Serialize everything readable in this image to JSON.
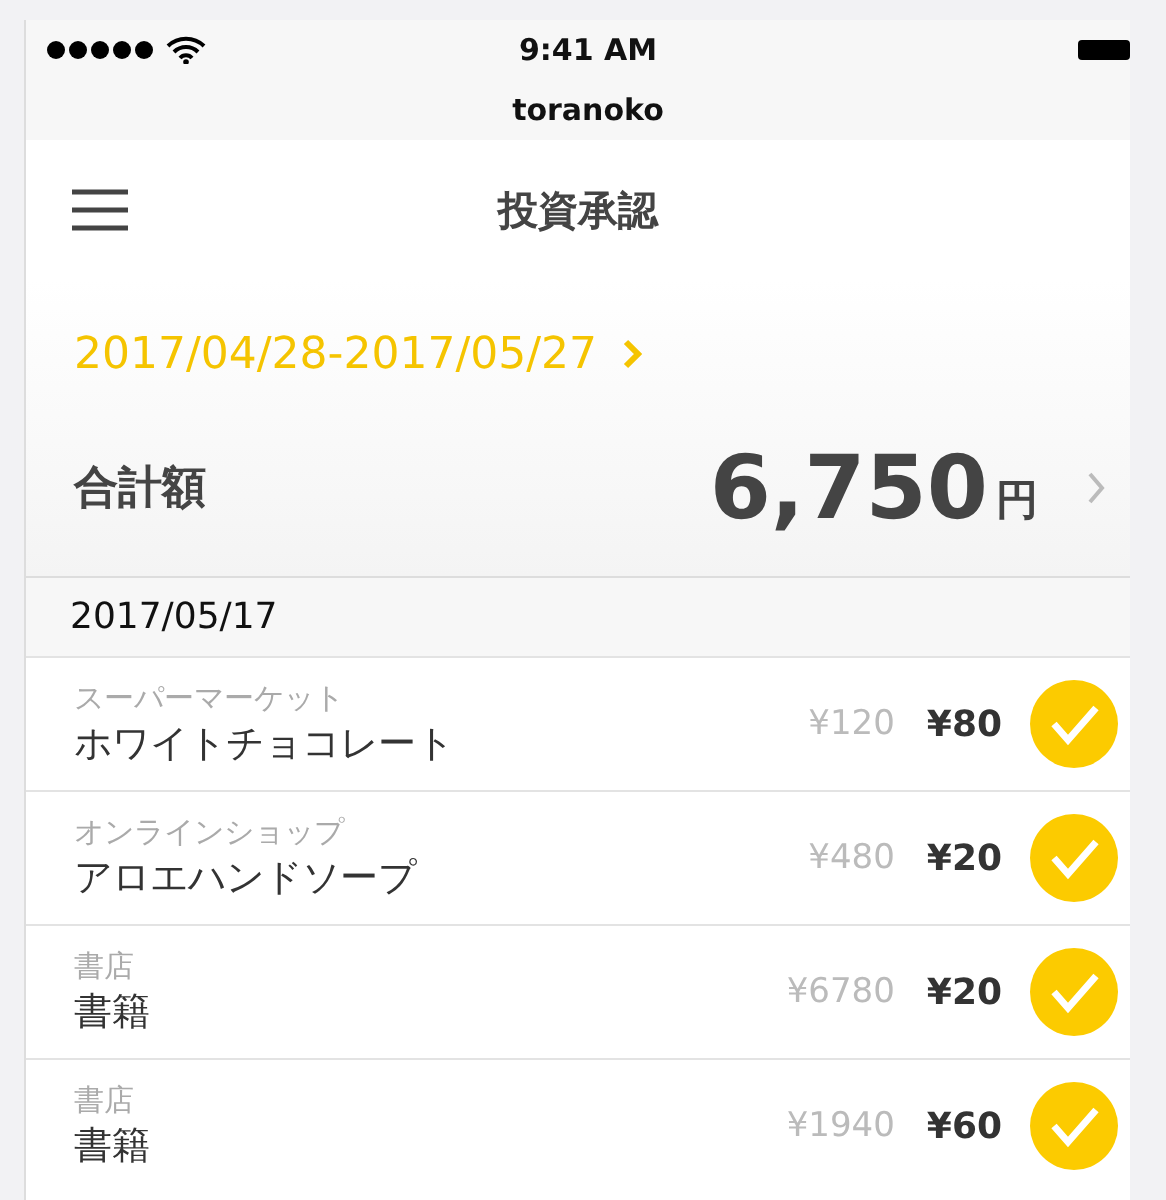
{
  "status_bar": {
    "time": "9:41 AM",
    "carrier": "toranoko"
  },
  "nav": {
    "title": "投資承認"
  },
  "period": {
    "range": "2017/04/28-2017/05/27"
  },
  "total": {
    "label": "合計額",
    "amount": "6,750",
    "unit": "円"
  },
  "sections": [
    {
      "date": "2017/05/17",
      "items": [
        {
          "shop": "スーパーマーケット",
          "name": "ホワイトチョコレート",
          "price": "¥120",
          "invest": "¥80",
          "checked": true
        },
        {
          "shop": "オンラインショップ",
          "name": "アロエハンドソープ",
          "price": "¥480",
          "invest": "¥20",
          "checked": true
        },
        {
          "shop": "書店",
          "name": "書籍",
          "price": "¥6780",
          "invest": "¥20",
          "checked": true
        },
        {
          "shop": "書店",
          "name": "書籍",
          "price": "¥1940",
          "invest": "¥60",
          "checked": true
        }
      ]
    }
  ]
}
